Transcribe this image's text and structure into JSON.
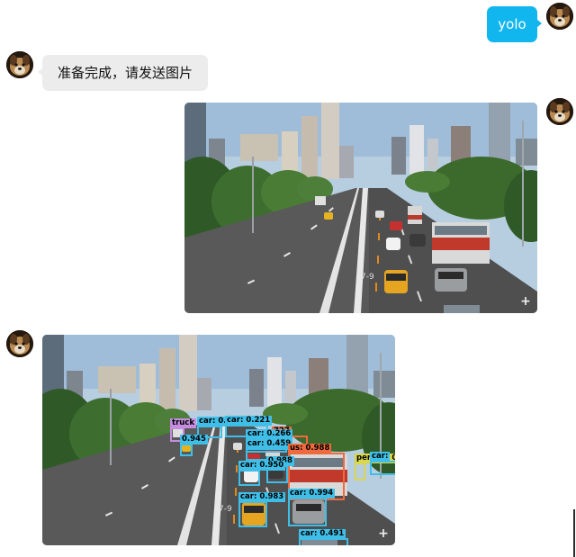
{
  "chat": {
    "user_message": "yolo",
    "bot_message": "准备完成，请发送图片"
  },
  "images": {
    "original": {
      "alt": "city street scene"
    },
    "detected": {
      "alt": "detection result"
    }
  },
  "detections": [
    {
      "label": "truck",
      "color": "#c58ce0"
    },
    {
      "label": "car: 0.",
      "color": "#3fbfe8"
    },
    {
      "label": "car: 0.221",
      "color": "#3fbfe8"
    },
    {
      "label": "727",
      "color": "#ef6a3f"
    },
    {
      "label": "0.945",
      "color": "#3fbfe8"
    },
    {
      "label": "car: 0.266",
      "color": "#3fbfe8"
    },
    {
      "label": "car: 0.459",
      "color": "#3fbfe8"
    },
    {
      "label": "us: 0.988",
      "color": "#ef6a3f"
    },
    {
      "label": "0.988",
      "color": "#3fbfe8"
    },
    {
      "label": "car: 0.950",
      "color": "#3fbfe8"
    },
    {
      "label": "car: 0.994",
      "color": "#3fbfe8"
    },
    {
      "label": "car: 0.983",
      "color": "#3fbfe8"
    },
    {
      "label": "car: 0.491",
      "color": "#3fbfe8"
    },
    {
      "label": "person: 0.",
      "color": "#d8d84a"
    },
    {
      "label": "car:",
      "color": "#3fbfe8"
    }
  ],
  "colors": {
    "user_bubble": "#12b6ef",
    "bot_bubble": "#ececec",
    "car_box": "#3fbfe8",
    "bus_box": "#ef6a3f",
    "person_box": "#d8d84a",
    "truck_box": "#c58ce0"
  },
  "icons": {
    "avatar": "dog-avatar-icon",
    "zoom": "expand-plus-icon"
  }
}
